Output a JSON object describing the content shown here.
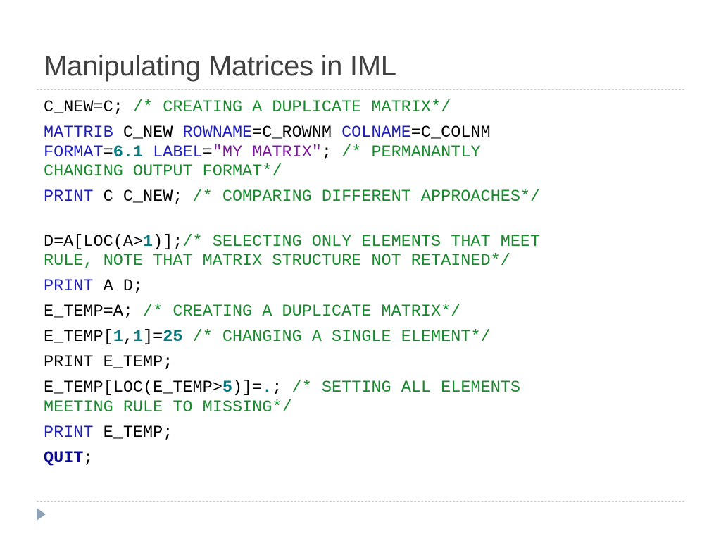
{
  "title": "Manipulating Matrices in IML",
  "code": [
    [
      {
        "text": "C_NEW=C; ",
        "style": "plain"
      },
      {
        "text": "/* CREATING A DUPLICATE MATRIX*/",
        "style": "comment"
      }
    ],
    [
      {
        "text": "MATTRIB",
        "style": "keyword"
      },
      {
        "text": " C_NEW ",
        "style": "plain"
      },
      {
        "text": "ROWNAME",
        "style": "keyword"
      },
      {
        "text": "=C_ROWNM ",
        "style": "plain"
      },
      {
        "text": "COLNAME",
        "style": "keyword"
      },
      {
        "text": "=C_COLNM",
        "style": "plain"
      },
      {
        "text": "\n",
        "style": "plain"
      },
      {
        "text": "FORMAT",
        "style": "keyword"
      },
      {
        "text": "=",
        "style": "plain"
      },
      {
        "text": "6.1",
        "style": "number"
      },
      {
        "text": " ",
        "style": "plain"
      },
      {
        "text": "LABEL",
        "style": "keyword"
      },
      {
        "text": "=",
        "style": "plain"
      },
      {
        "text": "\"MY MATRIX\"",
        "style": "string"
      },
      {
        "text": "; ",
        "style": "plain"
      },
      {
        "text": "/* PERMANANTLY",
        "style": "comment"
      },
      {
        "text": "\n",
        "style": "plain"
      },
      {
        "text": "CHANGING OUTPUT FORMAT*/",
        "style": "comment"
      }
    ],
    [
      {
        "text": "PRINT",
        "style": "keyword"
      },
      {
        "text": " C C_NEW; ",
        "style": "plain"
      },
      {
        "text": "/* COMPARING DIFFERENT APPROACHES*/",
        "style": "comment"
      }
    ],
    [
      {
        "text": "D=A[LOC(A>",
        "style": "plain"
      },
      {
        "text": "1",
        "style": "number"
      },
      {
        "text": ")];",
        "style": "plain"
      },
      {
        "text": "/* SELECTING ONLY ELEMENTS THAT MEET\nRULE, NOTE THAT MATRIX STRUCTURE NOT RETAINED*/",
        "style": "comment"
      }
    ],
    [
      {
        "text": "PRINT",
        "style": "keyword"
      },
      {
        "text": " A D;",
        "style": "plain"
      }
    ],
    [
      {
        "text": "E_TEMP=A; ",
        "style": "plain"
      },
      {
        "text": "/* CREATING A DUPLICATE MATRIX*/",
        "style": "comment"
      }
    ],
    [
      {
        "text": "E_TEMP[",
        "style": "plain"
      },
      {
        "text": "1",
        "style": "number"
      },
      {
        "text": ",",
        "style": "plain"
      },
      {
        "text": "1",
        "style": "number"
      },
      {
        "text": "]=",
        "style": "plain"
      },
      {
        "text": "25",
        "style": "number"
      },
      {
        "text": " ",
        "style": "plain"
      },
      {
        "text": "/* CHANGING A SINGLE ELEMENT*/",
        "style": "comment"
      }
    ],
    [
      {
        "text": "PRINT E_TEMP;",
        "style": "plain"
      }
    ],
    [
      {
        "text": "E_TEMP[LOC(E_TEMP>",
        "style": "plain"
      },
      {
        "text": "5",
        "style": "number"
      },
      {
        "text": ")]=",
        "style": "plain"
      },
      {
        "text": ".",
        "style": "number"
      },
      {
        "text": "; ",
        "style": "plain"
      },
      {
        "text": "/* SETTING ALL ELEMENTS\nMEETING RULE TO MISSING*/",
        "style": "comment"
      }
    ],
    [
      {
        "text": "PRINT",
        "style": "keyword"
      },
      {
        "text": " E_TEMP;",
        "style": "plain"
      }
    ],
    [
      {
        "text": "QUIT",
        "style": "bold-keyword"
      },
      {
        "text": ";",
        "style": "plain"
      }
    ]
  ],
  "colors": {
    "title": "#404040",
    "keyword": "#1f1fbd",
    "comment": "#1a8a2e",
    "number": "#007a80",
    "string": "#7a1a9a",
    "bold-keyword": "#0a0a8c",
    "rule": "#c3ccd6",
    "arrow": "#8fa2b8"
  },
  "icons": {
    "bullet": "triangle-right-icon"
  }
}
